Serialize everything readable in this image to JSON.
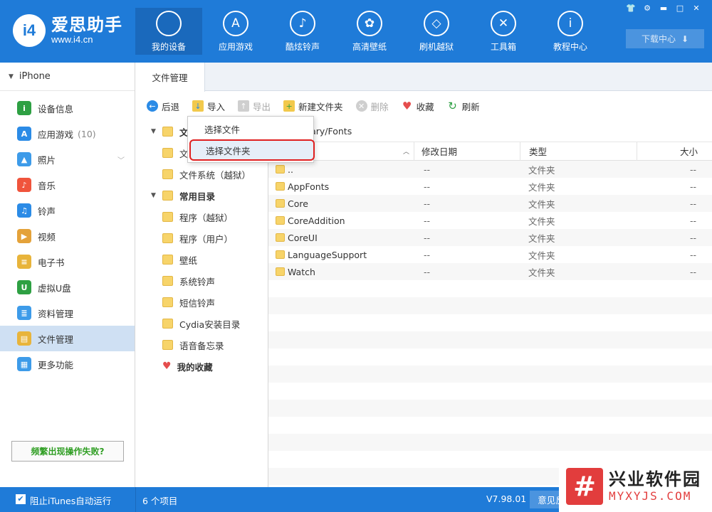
{
  "app": {
    "logo_badge": "i4",
    "name": "爱思助手",
    "url": "www.i4.cn"
  },
  "nav": [
    {
      "label": "我的设备",
      "icon": "apple-icon",
      "glyph": "",
      "active": true
    },
    {
      "label": "应用游戏",
      "icon": "appstore-icon",
      "glyph": "A",
      "active": false
    },
    {
      "label": "酷炫铃声",
      "icon": "bell-icon",
      "glyph": "♪",
      "active": false
    },
    {
      "label": "高清壁纸",
      "icon": "flower-icon",
      "glyph": "✿",
      "active": false
    },
    {
      "label": "刷机越狱",
      "icon": "box-icon",
      "glyph": "◇",
      "active": false
    },
    {
      "label": "工具箱",
      "icon": "tools-icon",
      "glyph": "✕",
      "active": false
    },
    {
      "label": "教程中心",
      "icon": "info-icon",
      "glyph": "i",
      "active": false
    }
  ],
  "window_controls": [
    "shirt-icon",
    "gear-icon",
    "minimize-icon",
    "maximize-icon",
    "close-icon"
  ],
  "download_center": "下载中心",
  "sidebar": {
    "device": "iPhone",
    "items": [
      {
        "label": "设备信息",
        "icon": "device-info-icon",
        "color": "#2ea043",
        "glyph": "i"
      },
      {
        "label": "应用游戏",
        "count": "(10)",
        "icon": "apps-icon",
        "color": "#2b8be6",
        "glyph": "A"
      },
      {
        "label": "照片",
        "icon": "photo-icon",
        "color": "#3d9be9",
        "glyph": "▲",
        "chevron": true
      },
      {
        "label": "音乐",
        "icon": "music-icon",
        "color": "#f0543c",
        "glyph": "♪"
      },
      {
        "label": "铃声",
        "icon": "ringtone-icon",
        "color": "#2b8be6",
        "glyph": "♫"
      },
      {
        "label": "视频",
        "icon": "video-icon",
        "color": "#e4a23a",
        "glyph": "▶"
      },
      {
        "label": "电子书",
        "icon": "ebook-icon",
        "color": "#e8b43b",
        "glyph": "≡"
      },
      {
        "label": "虚拟U盘",
        "icon": "usb-icon",
        "color": "#2ea043",
        "glyph": "U"
      },
      {
        "label": "资料管理",
        "icon": "data-icon",
        "color": "#3d9be9",
        "glyph": "≣"
      },
      {
        "label": "文件管理",
        "icon": "file-manager-icon",
        "color": "#e8b43b",
        "glyph": "▤",
        "active": true
      },
      {
        "label": "更多功能",
        "icon": "more-icon",
        "color": "#3d9be9",
        "glyph": "▦"
      }
    ],
    "help": "频繁出现操作失败?"
  },
  "tab": "文件管理",
  "toolbar": {
    "back": "后退",
    "import": "导入",
    "export": "导出",
    "new_folder": "新建文件夹",
    "delete": "删除",
    "favorite": "收藏",
    "refresh": "刷新"
  },
  "tree": {
    "root1": "文件系统",
    "root1_visible": "文",
    "child1": "文件系统",
    "child1_visible": "文",
    "child2": "文件系统（越狱）",
    "root2": "常用目录",
    "children": [
      "程序（越狱）",
      "程序（用户）",
      "壁纸",
      "系统铃声",
      "短信铃声",
      "Cydia安装目录",
      "语音备忘录"
    ],
    "favorites": "我的收藏"
  },
  "path": "brary/Fonts",
  "columns": {
    "name": "称",
    "modified": "修改日期",
    "type": "类型",
    "size": "大小"
  },
  "files": [
    {
      "name": "..",
      "modified": "--",
      "type": "文件夹",
      "size": "--"
    },
    {
      "name": "AppFonts",
      "modified": "--",
      "type": "文件夹",
      "size": "--"
    },
    {
      "name": "Core",
      "modified": "--",
      "type": "文件夹",
      "size": "--"
    },
    {
      "name": "CoreAddition",
      "modified": "--",
      "type": "文件夹",
      "size": "--"
    },
    {
      "name": "CoreUI",
      "modified": "--",
      "type": "文件夹",
      "size": "--"
    },
    {
      "name": "LanguageSupport",
      "modified": "--",
      "type": "文件夹",
      "size": "--"
    },
    {
      "name": "Watch",
      "modified": "--",
      "type": "文件夹",
      "size": "--"
    }
  ],
  "empty_rows": 12,
  "dropdown": {
    "select_file": "选择文件",
    "select_folder": "选择文件夹"
  },
  "status": {
    "itunes_block": "阻止iTunes自动运行",
    "item_count": "6 个项目",
    "version": "V7.98.01",
    "feedback": "意见反"
  },
  "watermark": {
    "logo": "#",
    "cn": "兴业软件园",
    "en": "MYXYJS.COM"
  },
  "colors": {
    "brand": "#1f7bd8",
    "highlight_border": "#e02020",
    "folder": "#f7d46a"
  }
}
